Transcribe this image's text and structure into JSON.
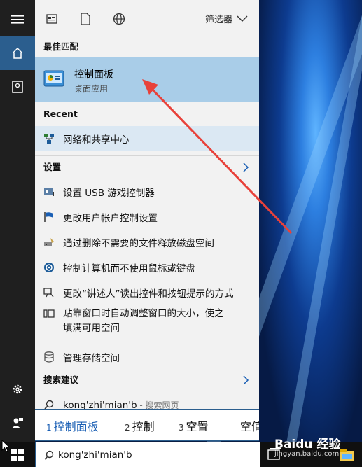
{
  "colors": {
    "accent": "#2b5e8e",
    "selected": "#a9cde8",
    "arrow": "#e8413a"
  },
  "rail": {
    "items": [
      {
        "icon": "hamburger-icon"
      },
      {
        "icon": "home-icon"
      },
      {
        "icon": "document-icon"
      },
      {
        "icon": "settings-gear-icon"
      },
      {
        "icon": "user-feedback-icon"
      }
    ]
  },
  "topbar": {
    "filter_label": "筛选器"
  },
  "best_match": {
    "heading": "最佳匹配",
    "title": "控制面板",
    "subtitle": "桌面应用"
  },
  "recent": {
    "heading": "Recent",
    "items": [
      {
        "label": "网络和共享中心"
      }
    ]
  },
  "settings": {
    "heading": "设置",
    "items": [
      {
        "label": "设置 USB 游戏控制器"
      },
      {
        "label": "更改用户帐户控制设置"
      },
      {
        "label": "通过删除不需要的文件释放磁盘空间"
      },
      {
        "label": "控制计算机而不使用鼠标或键盘"
      },
      {
        "label": "更改“讲述人”读出控件和按钮提示的方式"
      },
      {
        "label": "贴靠窗口时自动调整窗口的大小，使之",
        "label2": "填满可用空间"
      },
      {
        "label": "管理存储空间"
      }
    ]
  },
  "suggestions": {
    "heading": "搜索建议",
    "items": [
      {
        "label": "kong'zhi'mian'b",
        "hint": " - 搜索网页"
      }
    ]
  },
  "ime": {
    "candidates": [
      {
        "num": "1",
        "text": "控制面板"
      },
      {
        "num": "2",
        "text": "控制"
      },
      {
        "num": "3",
        "text": "空置"
      },
      {
        "num": "",
        "text": "空值"
      }
    ]
  },
  "taskbar": {
    "search_query": "kong'zhi'mian'b"
  },
  "watermark": {
    "brand": "Baidu 经验",
    "url": "jingyan.baidu.com"
  }
}
